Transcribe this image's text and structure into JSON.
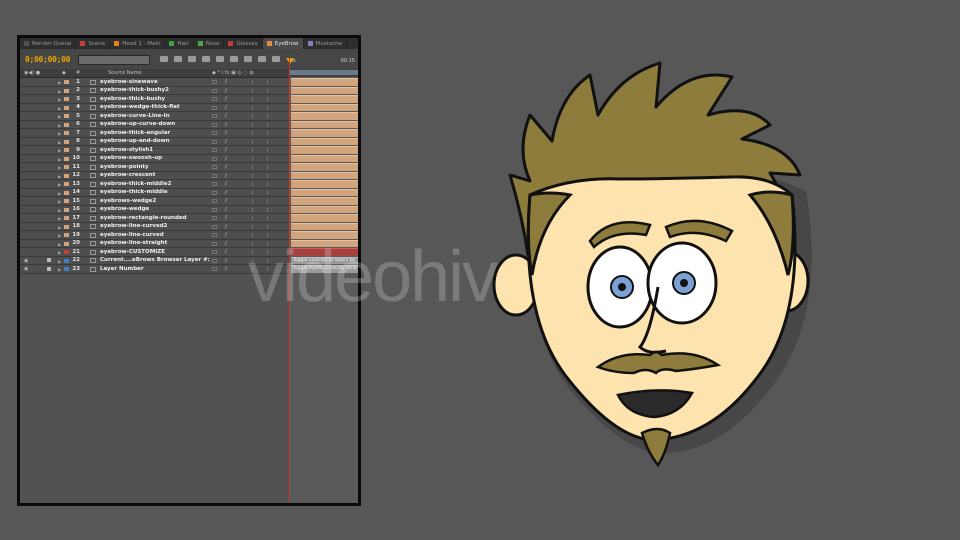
{
  "tabs": [
    {
      "label": "Render Queue",
      "color": "#505050",
      "active": false
    },
    {
      "label": "Scene",
      "color": "#c04040",
      "active": false
    },
    {
      "label": "Head 1 - Main",
      "color": "#e08020",
      "active": false
    },
    {
      "label": "Hair",
      "color": "#40a040",
      "active": false
    },
    {
      "label": "Nose",
      "color": "#50a050",
      "active": false
    },
    {
      "label": "Glasses",
      "color": "#c04040",
      "active": false
    },
    {
      "label": "EyeBrow",
      "color": "#e09040",
      "active": true
    },
    {
      "label": "Mustache",
      "color": "#8080c0",
      "active": false
    }
  ],
  "toolbar": {
    "timecode": "0;00;00;00",
    "search_placeholder": "",
    "ruler_start": "0s",
    "ruler_end": "00:15"
  },
  "columns": {
    "hash": "#",
    "source_name": "Source Name"
  },
  "layers": [
    {
      "num": "1",
      "name": "eyebrow-sinewave",
      "color": "#d2a57e",
      "bar": "normal",
      "bar_label": ""
    },
    {
      "num": "2",
      "name": "eyebrow-thick-bushy2",
      "color": "#d2a57e",
      "bar": "normal",
      "bar_label": ""
    },
    {
      "num": "3",
      "name": "eyebrow-thick-bushy",
      "color": "#d2a57e",
      "bar": "normal",
      "bar_label": ""
    },
    {
      "num": "4",
      "name": "eyebrow-wedge-thick-flat",
      "color": "#d2a57e",
      "bar": "normal",
      "bar_label": ""
    },
    {
      "num": "5",
      "name": "eyebrow-curve-Line-In",
      "color": "#d2a57e",
      "bar": "normal",
      "bar_label": ""
    },
    {
      "num": "6",
      "name": "eyebrow-up-curve-down",
      "color": "#d2a57e",
      "bar": "normal",
      "bar_label": ""
    },
    {
      "num": "7",
      "name": "eyebrow-thick-angular",
      "color": "#d2a57e",
      "bar": "normal",
      "bar_label": ""
    },
    {
      "num": "8",
      "name": "eyebrow-up-and-down",
      "color": "#d2a57e",
      "bar": "normal",
      "bar_label": ""
    },
    {
      "num": "9",
      "name": "eyebrow-stylish1",
      "color": "#d2a57e",
      "bar": "normal",
      "bar_label": ""
    },
    {
      "num": "10",
      "name": "eyebrow-swoosh-up",
      "color": "#d2a57e",
      "bar": "normal",
      "bar_label": ""
    },
    {
      "num": "11",
      "name": "eyebrow-pointy",
      "color": "#d2a57e",
      "bar": "normal",
      "bar_label": ""
    },
    {
      "num": "12",
      "name": "eyebrow-crescent",
      "color": "#d2a57e",
      "bar": "normal",
      "bar_label": ""
    },
    {
      "num": "13",
      "name": "eyebrow-thick-middle2",
      "color": "#d2a57e",
      "bar": "normal",
      "bar_label": ""
    },
    {
      "num": "14",
      "name": "eyebrow-thick-middle",
      "color": "#d2a57e",
      "bar": "normal",
      "bar_label": ""
    },
    {
      "num": "15",
      "name": "eyebrows-wedge2",
      "color": "#d2a57e",
      "bar": "normal",
      "bar_label": ""
    },
    {
      "num": "16",
      "name": "eyebrow-wedge",
      "color": "#d2a57e",
      "bar": "normal",
      "bar_label": ""
    },
    {
      "num": "17",
      "name": "eyebrow-rectangle-rounded",
      "color": "#d2a57e",
      "bar": "normal",
      "bar_label": ""
    },
    {
      "num": "18",
      "name": "eyebrow-line-curved2",
      "color": "#d2a57e",
      "bar": "normal",
      "bar_label": ""
    },
    {
      "num": "19",
      "name": "eyebrow-line-curved",
      "color": "#d2a57e",
      "bar": "normal",
      "bar_label": ""
    },
    {
      "num": "20",
      "name": "eyebrow-line-straight",
      "color": "#d2a57e",
      "bar": "normal",
      "bar_label": ""
    },
    {
      "num": "21",
      "name": "eyebrow-CUSTOMIZE",
      "color": "#c04040",
      "bar": "red",
      "bar_label": ""
    },
    {
      "num": "22",
      "name": "Current....eBrows Browser Layer #:",
      "color": "#4080c0",
      "bar": "text",
      "bar_label": "Toggle visibility of layers by"
    },
    {
      "num": "23",
      "name": "Layer Number",
      "color": "#4080c0",
      "bar": "text",
      "bar_label": "Toggle layers Currently visib"
    }
  ],
  "watermark": "videohive",
  "face_colors": {
    "skin": "#fde3ae",
    "hair": "#8d7c3c",
    "iris": "#7aa0d4",
    "outline": "#111111"
  }
}
